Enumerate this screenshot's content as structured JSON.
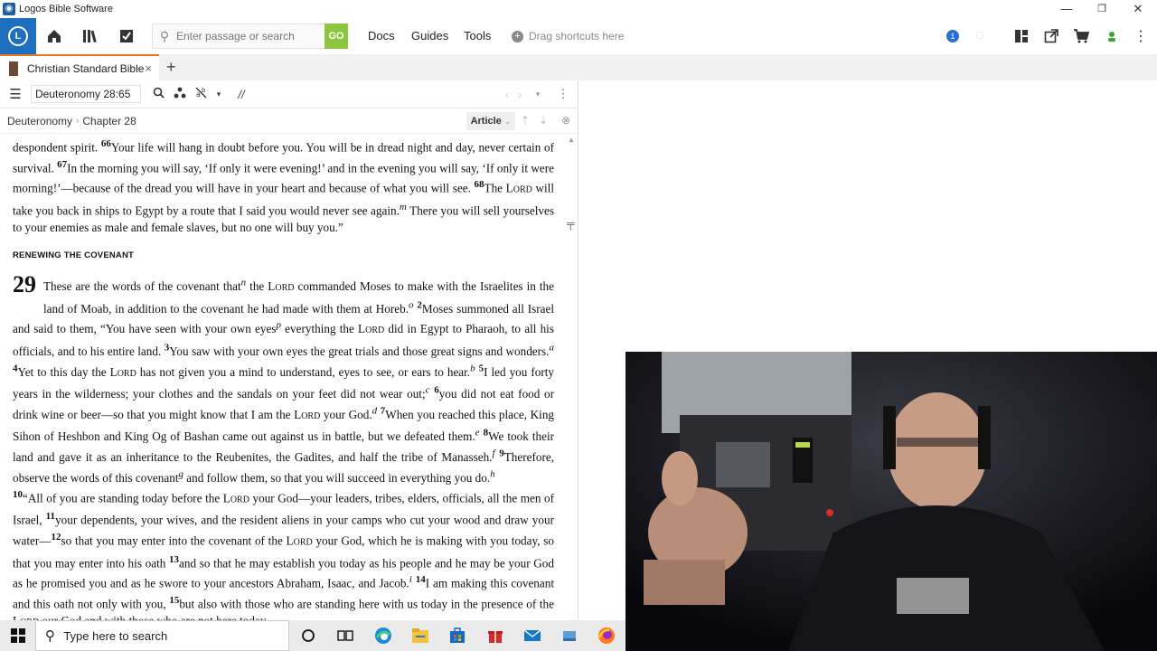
{
  "window": {
    "title": "Logos Bible Software",
    "minimize": "—",
    "restore": "❐",
    "close": "✕"
  },
  "toolbar": {
    "search_placeholder": "Enter passage or search",
    "go_label": "GO",
    "menu": [
      "Docs",
      "Guides",
      "Tools"
    ],
    "shortcuts_label": "Drag shortcuts here",
    "notification_count": "1",
    "accent": "#1e6fc0",
    "go_color": "#8cc63f"
  },
  "tab": {
    "title": "Christian Standard Bible",
    "close": "×",
    "add": "+"
  },
  "panel": {
    "reference": "Deuteronomy 28:65",
    "breadcrumb_book": "Deuteronomy",
    "breadcrumb_chapter": "Chapter 28",
    "article_label": "Article",
    "article_caret": "⌄",
    "parallel_label": "//"
  },
  "text": {
    "p1": "despondent spirit. <sup><b>66</b></sup>Your life will hang in doubt before you. You will be in dread night and day, never certain of survival. <sup><b>67</b></sup>In the morning you will say, ‘If only it were evening!’ and in the evening you will say, ‘If only it were morning!’—because of the dread you will have in your heart and because of what you will see. <sup><b>68</b></sup>The L<span style=\"font-size:10px\">ORD</span> will take you back in ships to Egypt by a route that I said you would never see again.<sup><i>m</i></sup> There you will sell yourselves to your enemies as male and female slaves, but no one will buy you.”",
    "heading": "RENEWING THE COVENANT",
    "chapter": "29",
    "p2": "These are the words of the covenant that<sup><i>n</i></sup> the L<span style=\"font-size:10px\">ORD</span> commanded Moses to make with the Israelites in the land of Moab, in addition to the covenant he had made with them at Horeb.<sup><i>o</i></sup> <sup><b>2</b></sup>Moses summoned all Israel and said to them, “You have seen with your own eyes<sup><i>p</i></sup> everything the L<span style=\"font-size:10px\">ORD</span> did in Egypt to Pharaoh, to all his officials, and to his entire land. <sup><b>3</b></sup>You saw with your own eyes the great trials and those great signs and wonders.<sup><i>a</i></sup> <sup><b>4</b></sup>Yet to this day the L<span style=\"font-size:10px\">ORD</span> has not given you a mind to understand, eyes to see, or ears to hear.<sup><i>b</i></sup> <sup><b>5</b></sup>I led you forty years in the wilderness; your clothes and the sandals on your feet did not wear out;<sup><i>c</i></sup> <sup><b>6</b></sup>you did not eat food or drink wine or beer—so that you might know that I am the L<span style=\"font-size:10px\">ORD</span> your God.<sup><i>d</i></sup> <sup><b>7</b></sup>When you reached this place, King Sihon of Heshbon and King Og of Bashan came out against us in battle, but we defeated them.<sup><i>e</i></sup> <sup><b>8</b></sup>We took their land and gave it as an inheritance to the Reubenites, the Gadites, and half the tribe of Manasseh.<sup><i>f</i></sup> <sup><b>9</b></sup>Therefore, observe the words of this covenant<sup><i>g</i></sup> and follow them, so that you will succeed in everything you do.<sup><i>h</i></sup>",
    "p3": "<sup><b>10</b></sup>“All of you are standing today before the L<span style=\"font-size:10px\">ORD</span> your God—your leaders, tribes, elders, officials, all the men of Israel, <sup><b>11</b></sup>your dependents, your wives, and the resident aliens in your camps who cut your wood and draw your water—<sup><b>12</b></sup>so that you may enter into the covenant of the L<span style=\"font-size:10px\">ORD</span> your God, which he is making with you today, so that you may enter into his oath <sup><b>13</b></sup>and so that he may establish you today as his people and he may be your God as he promised you and as he swore to your ancestors Abraham, Isaac, and Jacob.<sup><i>i</i></sup> <sup><b>14</b></sup>I am making this covenant and this oath not only with you, <sup><b>15</b></sup>but also with those who are standing here with us today in the presence of the L<span style=\"font-size:10px\">ORD</span> our God and with those who are not here today."
  },
  "taskbar": {
    "search_placeholder": "Type here to search"
  }
}
